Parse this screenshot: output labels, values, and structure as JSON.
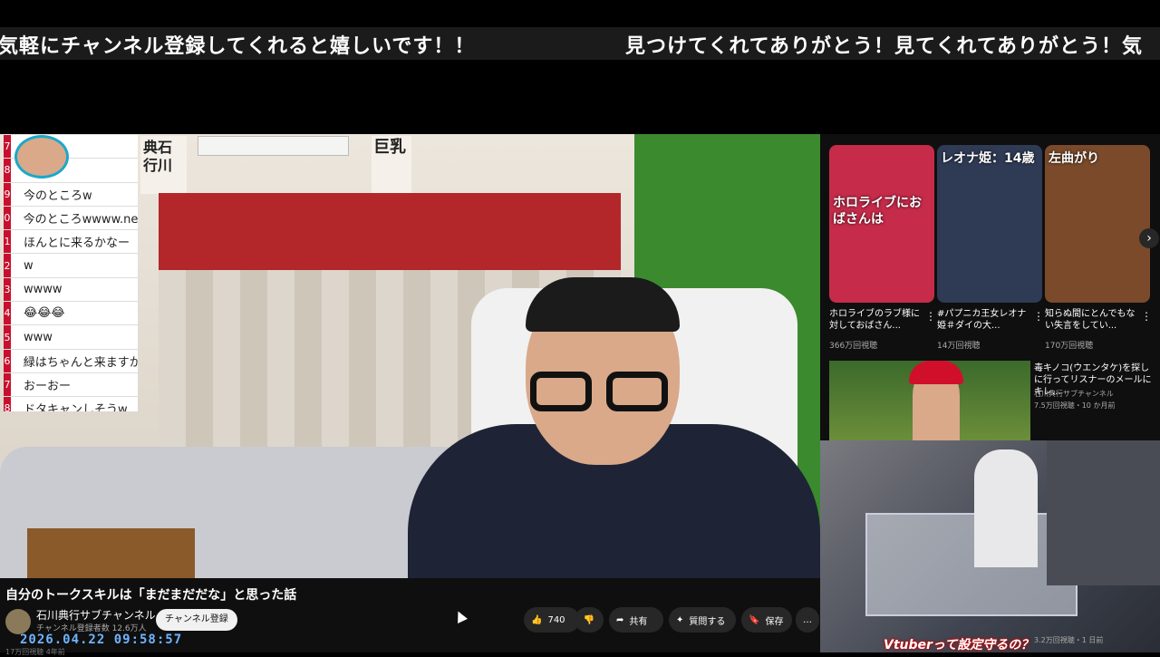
{
  "ticker": {
    "text_left": "気軽にチャンネル登録してくれると嬉しいです！！",
    "text_right": "見つけてくれてありがとう！見てくれてありがとう！気"
  },
  "chat": {
    "rows": [
      {
        "num": "7",
        "text": ""
      },
      {
        "num": "8",
        "text": ""
      },
      {
        "num": "9",
        "text": "今のところw"
      },
      {
        "num": "0",
        "text": "今のところwwww.net"
      },
      {
        "num": "1",
        "text": "ほんとに来るかなー"
      },
      {
        "num": "2",
        "text": "w"
      },
      {
        "num": "3",
        "text": "wwww"
      },
      {
        "num": "4",
        "text": "😂😂😂"
      },
      {
        "num": "5",
        "text": "www"
      },
      {
        "num": "6",
        "text": "緑はちゃんと来ますか"
      },
      {
        "num": "7",
        "text": "おーおー"
      },
      {
        "num": "8",
        "text": "ドタキャンしそうw"
      }
    ]
  },
  "video": {
    "title": "自分のトークスキルは「まだまだだな」と思った話",
    "channel_name": "石川典行サブチャンネル",
    "subscribers": "チャンネル登録者数 12.6万人",
    "subscribe_label": "チャンネル登録",
    "like_count": "740",
    "share_label": "共有",
    "ask_label": "質問する",
    "save_label": "保存",
    "more_label": "…",
    "datetime": "2026.04.22 09:58:57",
    "sub_line": "17万回視聴 4年前"
  },
  "shorts": [
    {
      "title": "ホロライブのラブ様に対しておばさん...",
      "views": "366万回視聴",
      "thumb_text": "ホロライブにおばさんは",
      "color": "#c62b4a"
    },
    {
      "title": "#パプニカ王女レオナ姫＃ダイの大...",
      "views": "14万回視聴",
      "thumb_text": "レオナ姫：14歳",
      "color": "#2f3b55"
    },
    {
      "title": "知らぬ間にとんでもない失言をしてい...",
      "views": "170万回視聴",
      "thumb_text": "左曲がり",
      "color": "#7a4a2a"
    }
  ],
  "recommended": {
    "title": "毒キノコ(ウエンタケ)を探しに行ってリスナーのメールにキレ...",
    "channel": "石川典行サブチャンネル",
    "meta": "7.5万回視聴・10 か月前"
  },
  "popup": {
    "caption": "Vtuberって設定守るの？",
    "meta": "3.2万回視聴・1 日前"
  },
  "wall_text": {
    "poster1": "典石行川",
    "poster2": "巨乳"
  }
}
